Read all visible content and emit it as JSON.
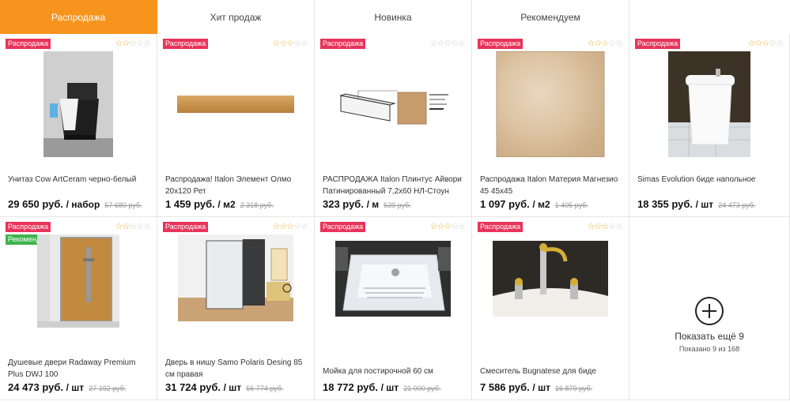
{
  "tabs": [
    {
      "label": "Распродажа"
    },
    {
      "label": "Хит продаж"
    },
    {
      "label": "Новинка"
    },
    {
      "label": "Рекомендуем"
    }
  ],
  "badges": {
    "sale": "Распродажа",
    "recommend": "Рекомендуем"
  },
  "products": [
    {
      "title": "Унитаз Cow ArtCeram черно-белый",
      "price": "29 650 руб.",
      "unit": "/ набор",
      "old_price": "57 680 руб.",
      "rating": 2
    },
    {
      "title": "Распродажа! Italon Элемент Олмо 20х120 Рет",
      "price": "1 459 руб.",
      "unit": "/ м2",
      "old_price": "2 318 руб.",
      "rating": 3
    },
    {
      "title": "РАСПРОДАЖА Italon Плинтус Айвори Патинированный 7,2х60 НЛ-Стоун",
      "price": "323 руб.",
      "unit": "/ м",
      "old_price": "539 руб.",
      "rating": 0
    },
    {
      "title": "Распродажа Italon Материя Магнезио 45 45х45",
      "price": "1 097 руб.",
      "unit": "/ м2",
      "old_price": "1 405 руб.",
      "rating": 3
    },
    {
      "title": "Simas Evolution биде напольное",
      "price": "18 355 руб.",
      "unit": "/ шт",
      "old_price": "24 473 руб.",
      "rating": 3
    },
    {
      "title": "Душевые двери Radaway Premium Plus DWJ 100",
      "price": "24 473 руб.",
      "unit": "/ шт",
      "old_price": "27 192 руб.",
      "rating": 2
    },
    {
      "title": "Дверь в нишу Samo Polaris Desing 85 см правая",
      "price": "31 724 руб.",
      "unit": "/ шт",
      "old_price": "56 774 руб.",
      "rating": 3
    },
    {
      "title": "Мойка для постирочной 60 см",
      "price": "18 772 руб.",
      "unit": "/ шт",
      "old_price": "21 000 руб.",
      "rating": 3
    },
    {
      "title": "Смеситель Bugnatese для биде",
      "price": "7 586 руб.",
      "unit": "/ шт",
      "old_price": "16 879 руб.",
      "rating": 3
    }
  ],
  "show_more": {
    "label": "Показать ещё 9",
    "sub": "Показано 9 из 168"
  },
  "colors": {
    "accent": "#f7941d",
    "sale_badge": "#e8335a",
    "recommend_badge": "#3fb34f",
    "star": "#f5a623"
  }
}
